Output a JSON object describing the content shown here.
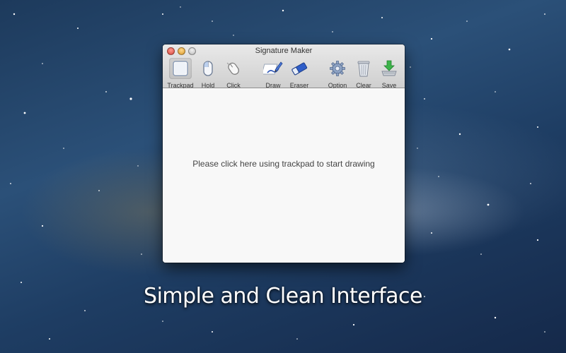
{
  "window": {
    "title": "Signature Maker",
    "hint": "Please click here using trackpad to start drawing"
  },
  "toolbar": {
    "trackpad": {
      "label": "Trackpad",
      "icon": "trackpad-icon",
      "selected": true
    },
    "hold": {
      "label": "Hold",
      "icon": "mouse-icon"
    },
    "click": {
      "label": "Click",
      "icon": "mouse-click-icon"
    },
    "draw": {
      "label": "Draw",
      "icon": "pen-draw-icon"
    },
    "eraser": {
      "label": "Eraser",
      "icon": "eraser-icon"
    },
    "option": {
      "label": "Option",
      "icon": "gear-icon"
    },
    "clear": {
      "label": "Clear",
      "icon": "trash-icon"
    },
    "save": {
      "label": "Save",
      "icon": "save-download-icon"
    }
  },
  "caption": "Simple and Clean Interface",
  "colors": {
    "accent_green": "#3cb34a",
    "accent_blue": "#3a64c8",
    "close": "#d6473c",
    "minimize": "#d9982a"
  }
}
